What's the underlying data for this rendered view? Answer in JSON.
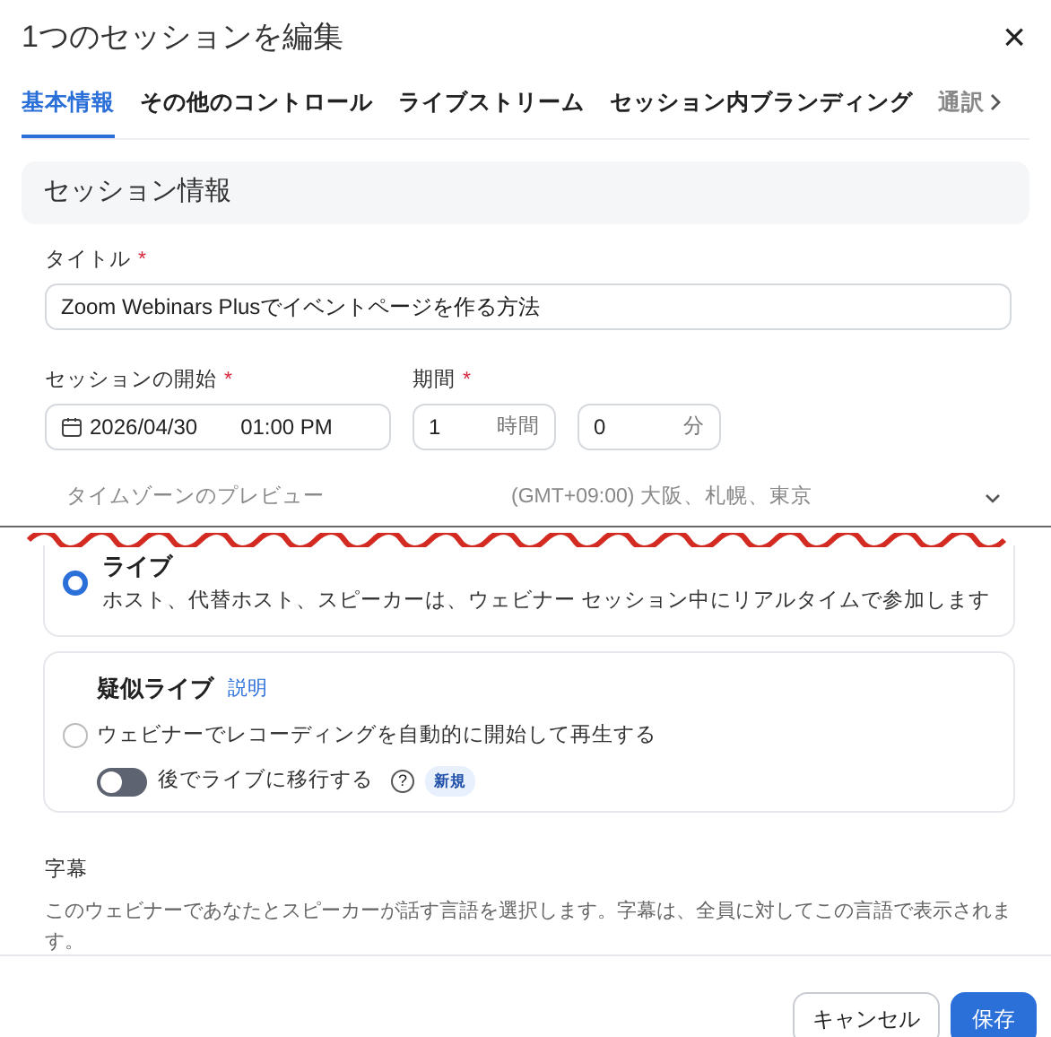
{
  "dialog": {
    "title": "1つのセッションを編集",
    "close": "×"
  },
  "tabs": [
    {
      "label": "基本情報",
      "selected": true
    },
    {
      "label": "その他のコントロール",
      "selected": false
    },
    {
      "label": "ライブストリーム",
      "selected": false
    },
    {
      "label": "セッション内ブランディング",
      "selected": false
    },
    {
      "label": "通訳",
      "selected": false
    }
  ],
  "section": {
    "title": "セッション情報"
  },
  "title_field": {
    "label": "タイトル",
    "required_mark": "*",
    "value": "Zoom Webinars Plusでイベントページを作る方法"
  },
  "start": {
    "label": "セッションの開始",
    "required_mark": "*",
    "date": "2026/04/30",
    "time": "01:00 PM"
  },
  "duration": {
    "label": "期間",
    "required_mark": "*",
    "hours": "1",
    "hours_unit": "時間",
    "minutes": "0",
    "minutes_unit": "分"
  },
  "timezone": {
    "label": "タイムゾーンのプレビュー",
    "value": "(GMT+09:00) 大阪、札幌、東京"
  },
  "modes": [
    {
      "kind": "live",
      "title": "ライブ",
      "selected": true,
      "description": "ホスト、代替ホスト、スピーカーは、ウェビナー セッション中にリアルタイムで参加します"
    },
    {
      "kind": "simulive",
      "title": "疑似ライブ",
      "link": "説明",
      "selected": false,
      "description": "ウェビナーでレコーディングを自動的に開始して再生する",
      "toggle": {
        "label": "後でライブに移行する",
        "on": false,
        "help": "?",
        "badge": "新規"
      }
    }
  ],
  "captions": {
    "title": "字幕",
    "description": "このウェビナーであなたとスピーカーが話す言語を選択します。字幕は、全員に対してこの言語で表示されます。"
  },
  "buttons": [
    {
      "label": "キャンセル",
      "kind": "secondary"
    },
    {
      "label": "保存",
      "kind": "primary"
    }
  ]
}
